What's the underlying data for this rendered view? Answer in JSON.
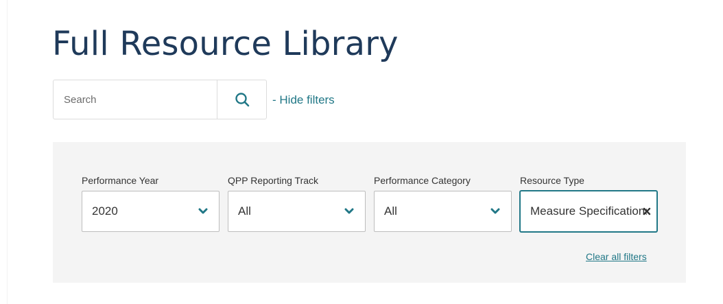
{
  "page": {
    "title": "Full Resource Library"
  },
  "search": {
    "placeholder": "Search"
  },
  "links": {
    "hide_filters": "- Hide filters",
    "clear_all": "Clear all filters"
  },
  "filters": [
    {
      "label": "Performance Year",
      "value": "2020"
    },
    {
      "label": "QPP Reporting Track",
      "value": "All"
    },
    {
      "label": "Performance Category",
      "value": "All"
    },
    {
      "label": "Resource Type",
      "value": "Measure Specifications"
    }
  ],
  "colors": {
    "title": "#1f3a5a",
    "accent": "#207786",
    "panel_bg": "#f4f4f4",
    "border": "#bdbdbd"
  },
  "icons": {
    "search": "search-icon",
    "chevron": "chevron-down-icon",
    "clear": "close-icon"
  }
}
